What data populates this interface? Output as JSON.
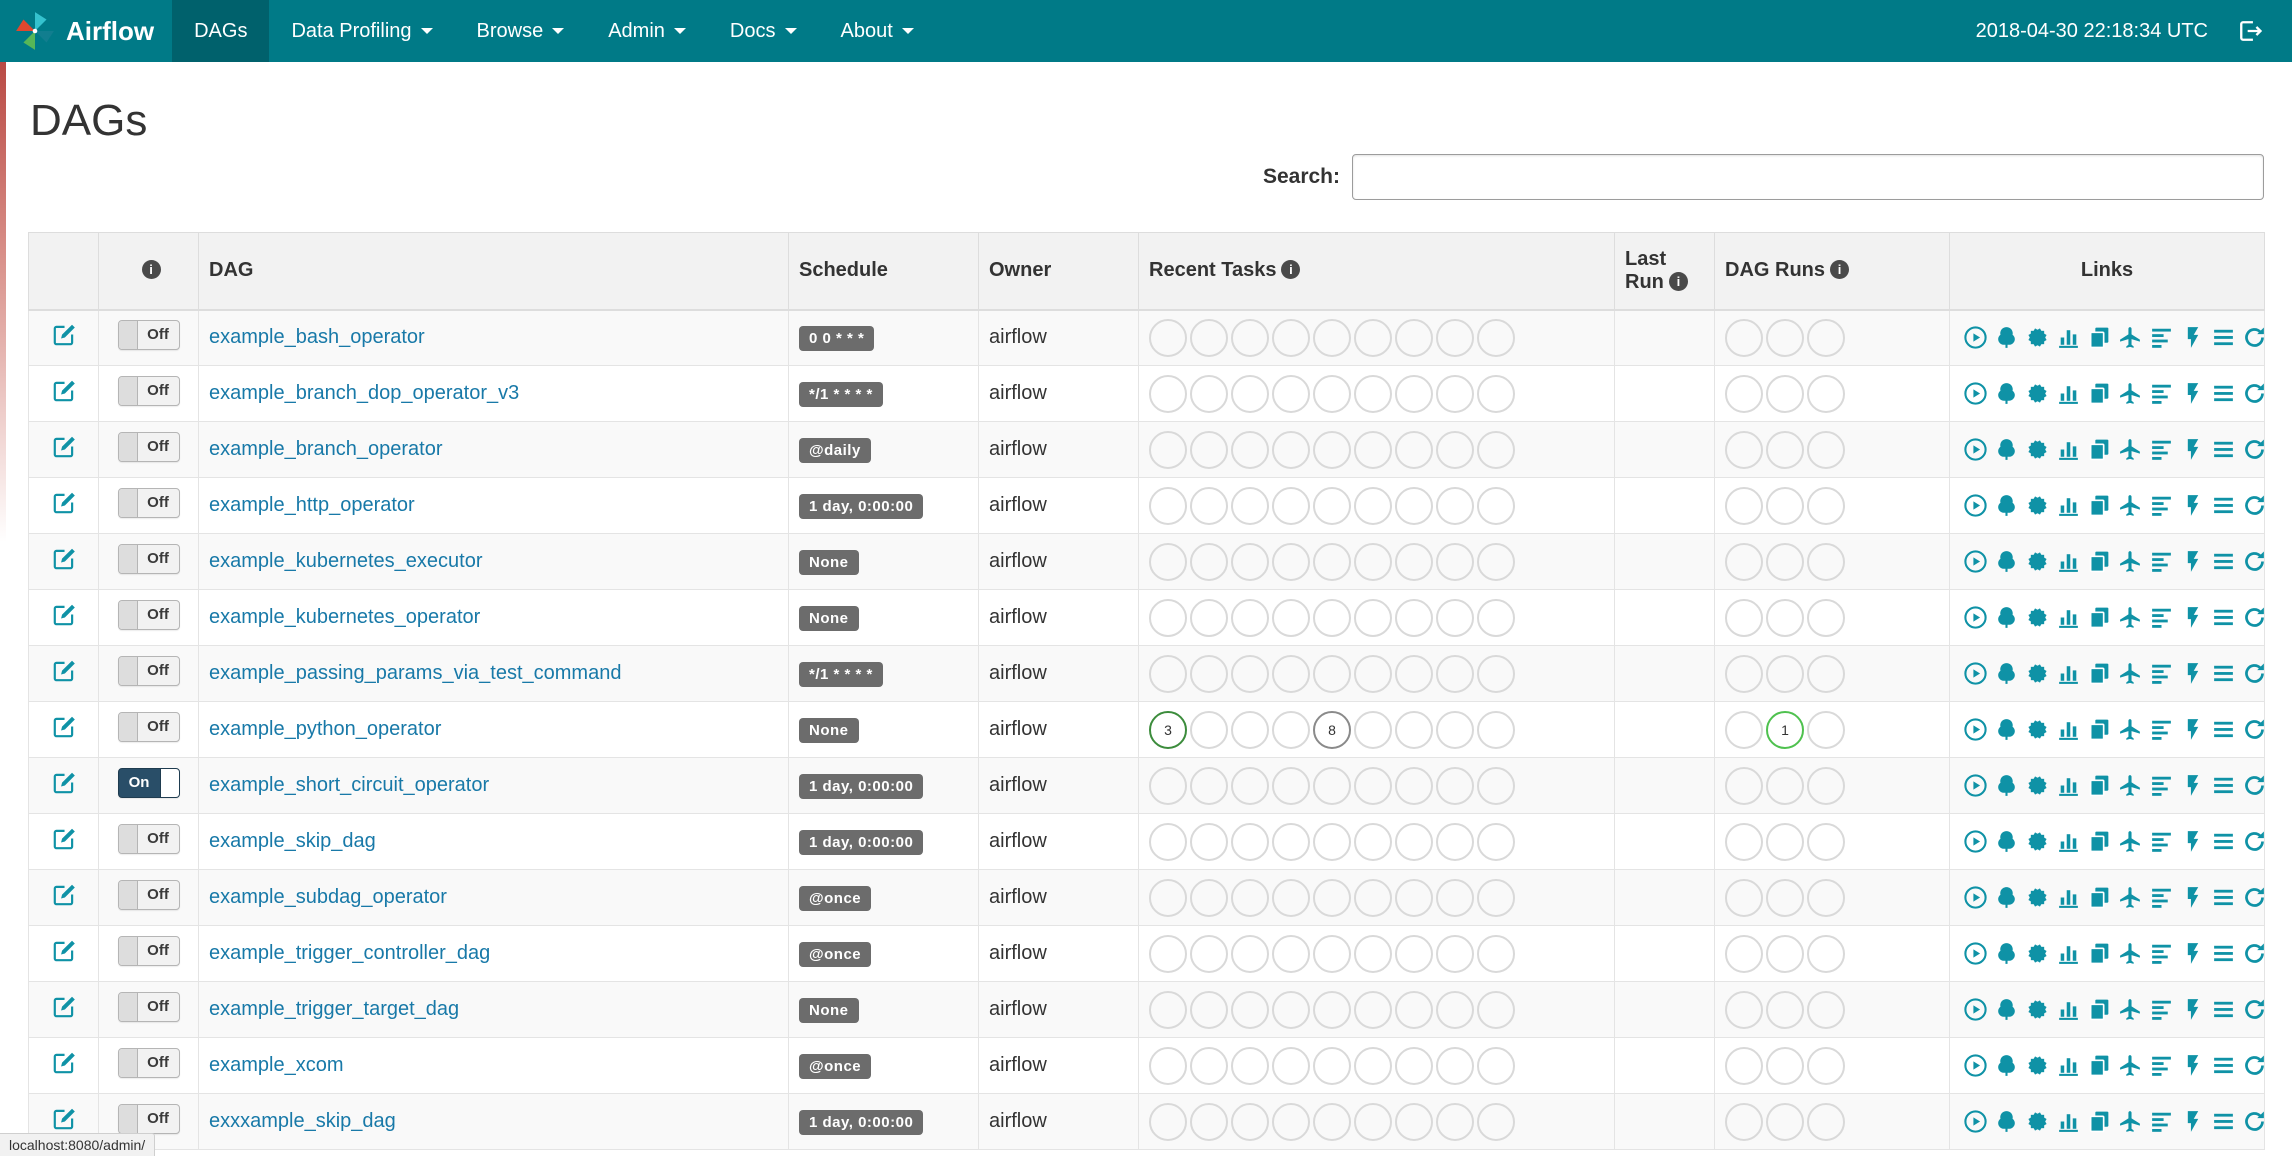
{
  "colors": {
    "navbar_bg": "#007A87",
    "navbar_active_bg": "#00616c",
    "link_color": "#1879a8",
    "icon_teal": "#0f92a6",
    "badge_bg": "#6c6c6c",
    "toggle_on_bg": "#294e68",
    "circle_empty": "#d9d9d9",
    "header_bg": "#f2f2f2",
    "success_green": "#3c8c3c",
    "running_lime": "#4fc14f",
    "queued_gray": "#8a8a8a"
  },
  "navbar": {
    "brand": "Airflow",
    "items": [
      {
        "label": "DAGs"
      },
      {
        "label": "Data Profiling"
      },
      {
        "label": "Browse"
      },
      {
        "label": "Admin"
      },
      {
        "label": "Docs"
      },
      {
        "label": "About"
      }
    ],
    "clock": "2018-04-30 22:18:34 UTC"
  },
  "page": {
    "title": "DAGs",
    "search_label": "Search:"
  },
  "table": {
    "headers": {
      "dag": "DAG",
      "schedule": "Schedule",
      "owner": "Owner",
      "recent_tasks": "Recent Tasks",
      "last_run": "Last Run",
      "dag_runs": "DAG Runs",
      "links": "Links"
    },
    "toggle_off_label": "Off",
    "toggle_on_label": "On",
    "recent_task_slots": 9,
    "dag_run_slots": 3,
    "links": [
      {
        "name": "trigger-dag-icon",
        "symbol": "play-circle"
      },
      {
        "name": "tree-view-icon",
        "symbol": "tree"
      },
      {
        "name": "graph-view-icon",
        "symbol": "certificate"
      },
      {
        "name": "task-duration-icon",
        "symbol": "stats"
      },
      {
        "name": "task-tries-icon",
        "symbol": "duplicate"
      },
      {
        "name": "landing-times-icon",
        "symbol": "plane"
      },
      {
        "name": "gantt-view-icon",
        "symbol": "align-left"
      },
      {
        "name": "code-view-icon",
        "symbol": "flash"
      },
      {
        "name": "logs-icon",
        "symbol": "list"
      },
      {
        "name": "refresh-icon",
        "symbol": "refresh"
      }
    ]
  },
  "dags": [
    {
      "name": "example_bash_operator",
      "schedule": "0 0 * * *",
      "owner": "airflow",
      "paused": true,
      "recent_tasks": [],
      "dag_runs": []
    },
    {
      "name": "example_branch_dop_operator_v3",
      "schedule": "*/1 * * * *",
      "owner": "airflow",
      "paused": true,
      "recent_tasks": [],
      "dag_runs": []
    },
    {
      "name": "example_branch_operator",
      "schedule": "@daily",
      "owner": "airflow",
      "paused": true,
      "recent_tasks": [],
      "dag_runs": []
    },
    {
      "name": "example_http_operator",
      "schedule": "1 day, 0:00:00",
      "owner": "airflow",
      "paused": true,
      "recent_tasks": [],
      "dag_runs": []
    },
    {
      "name": "example_kubernetes_executor",
      "schedule": "None",
      "owner": "airflow",
      "paused": true,
      "recent_tasks": [],
      "dag_runs": []
    },
    {
      "name": "example_kubernetes_operator",
      "schedule": "None",
      "owner": "airflow",
      "paused": true,
      "recent_tasks": [],
      "dag_runs": []
    },
    {
      "name": "example_passing_params_via_test_command",
      "schedule": "*/1 * * * *",
      "owner": "airflow",
      "paused": true,
      "recent_tasks": [],
      "dag_runs": []
    },
    {
      "name": "example_python_operator",
      "schedule": "None",
      "owner": "airflow",
      "paused": true,
      "recent_tasks": [
        {
          "slot": 0,
          "count": 3,
          "color": "#3c8c3c"
        },
        {
          "slot": 4,
          "count": 8,
          "color": "#8a8a8a"
        }
      ],
      "dag_runs": [
        {
          "slot": 1,
          "count": 1,
          "color": "#4fc14f"
        }
      ]
    },
    {
      "name": "example_short_circuit_operator",
      "schedule": "1 day, 0:00:00",
      "owner": "airflow",
      "paused": false,
      "recent_tasks": [],
      "dag_runs": []
    },
    {
      "name": "example_skip_dag",
      "schedule": "1 day, 0:00:00",
      "owner": "airflow",
      "paused": true,
      "recent_tasks": [],
      "dag_runs": []
    },
    {
      "name": "example_subdag_operator",
      "schedule": "@once",
      "owner": "airflow",
      "paused": true,
      "recent_tasks": [],
      "dag_runs": []
    },
    {
      "name": "example_trigger_controller_dag",
      "schedule": "@once",
      "owner": "airflow",
      "paused": true,
      "recent_tasks": [],
      "dag_runs": []
    },
    {
      "name": "example_trigger_target_dag",
      "schedule": "None",
      "owner": "airflow",
      "paused": true,
      "recent_tasks": [],
      "dag_runs": []
    },
    {
      "name": "example_xcom",
      "schedule": "@once",
      "owner": "airflow",
      "paused": true,
      "recent_tasks": [],
      "dag_runs": []
    },
    {
      "name": "exxxample_skip_dag",
      "schedule": "1 day, 0:00:00",
      "owner": "airflow",
      "paused": true,
      "recent_tasks": [],
      "dag_runs": []
    }
  ],
  "statusbar": "localhost:8080/admin/"
}
